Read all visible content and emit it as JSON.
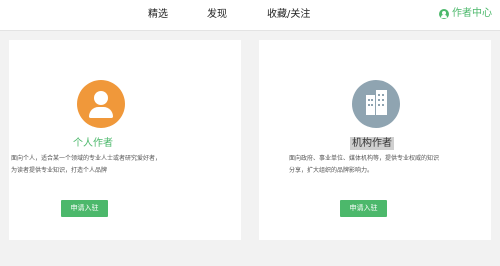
{
  "nav": {
    "tabs": [
      {
        "label": "精选"
      },
      {
        "label": "发现"
      },
      {
        "label": "收藏/关注"
      }
    ],
    "author_center": "作者中心"
  },
  "cards": [
    {
      "title": "个人作者",
      "description": "面向个人，适合某一个领域的专业人士或者研究爱好者，为读者提供专业知识，打造个人品牌",
      "button": "申请入驻",
      "icon": "person-icon"
    },
    {
      "title": "机构作者",
      "description": "面向政府、事业单位、媒体机构等，提供专业权威的知识分享，扩大组织的品牌影响力。",
      "button": "申请入驻",
      "icon": "building-icon"
    }
  ],
  "colors": {
    "accent": "#4cb86b",
    "personal_avatar": "#f0983a",
    "org_avatar": "#8fa4b1"
  }
}
